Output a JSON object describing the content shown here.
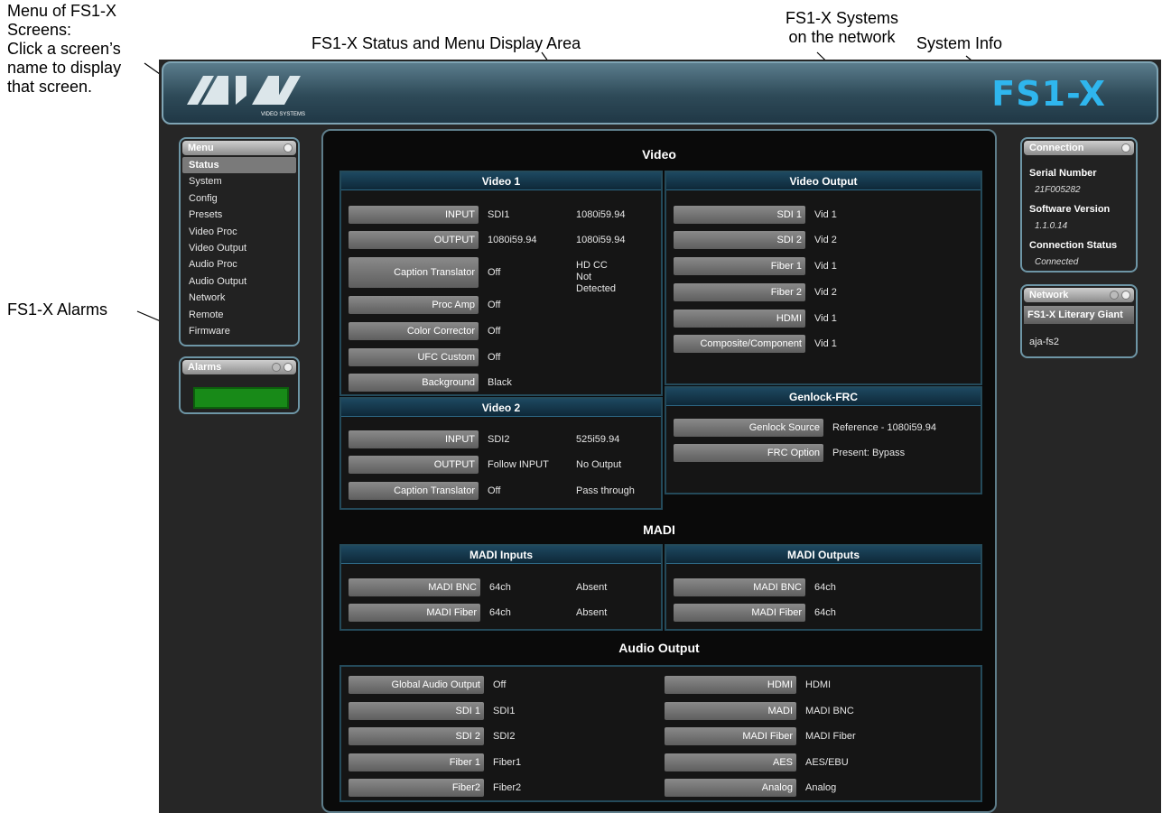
{
  "callouts": {
    "menu": "Menu of FS1-X\nScreens:\nClick a screen’s\nname to display\nthat screen.",
    "display_area": "FS1-X Status and Menu Display Area",
    "systems": "FS1-X Systems\non the network",
    "system_info": "System Info",
    "alarms": "FS1-X Alarms"
  },
  "header": {
    "logo_text": "AJA",
    "logo_sub": "VIDEO SYSTEMS",
    "product": "FS1-X",
    "accent": "#2fb6ee"
  },
  "menu": {
    "title": "Menu",
    "items": [
      {
        "label": "Status",
        "selected": true
      },
      {
        "label": "System"
      },
      {
        "label": "Config"
      },
      {
        "label": "Presets"
      },
      {
        "label": "Video Proc"
      },
      {
        "label": "Video Output"
      },
      {
        "label": "Audio Proc"
      },
      {
        "label": "Audio Output"
      },
      {
        "label": "Network"
      },
      {
        "label": "Remote"
      },
      {
        "label": "Firmware"
      }
    ]
  },
  "alarms": {
    "title": "Alarms",
    "status_color": "#188a18"
  },
  "connection": {
    "title": "Connection",
    "serial_label": "Serial Number",
    "serial_value": "21F005282",
    "software_label": "Software Version",
    "software_value": "1.1.0.14",
    "status_label": "Connection Status",
    "status_value": "Connected"
  },
  "network": {
    "title": "Network",
    "systems": [
      "FS1-X Literary Giant",
      "aja-fs2"
    ]
  },
  "video": {
    "heading": "Video",
    "video1": {
      "title": "Video 1",
      "rows": [
        {
          "btn": "INPUT",
          "v1": "SDI1",
          "v2": "1080i59.94"
        },
        {
          "btn": "OUTPUT",
          "v1": "1080i59.94",
          "v2": "1080i59.94"
        },
        {
          "btn": "Caption Translator",
          "v1": "Off",
          "v2": "HD CC Not\nDetected"
        },
        {
          "btn": "Proc Amp",
          "v1": "Off",
          "v2": ""
        },
        {
          "btn": "Color Corrector",
          "v1": "Off",
          "v2": ""
        },
        {
          "btn": "UFC Custom",
          "v1": "Off",
          "v2": ""
        },
        {
          "btn": "Background",
          "v1": "Black",
          "v2": ""
        }
      ]
    },
    "video2": {
      "title": "Video 2",
      "rows": [
        {
          "btn": "INPUT",
          "v1": "SDI2",
          "v2": "525i59.94"
        },
        {
          "btn": "OUTPUT",
          "v1": "Follow INPUT",
          "v2": "No Output"
        },
        {
          "btn": "Caption Translator",
          "v1": "Off",
          "v2": "Pass through"
        }
      ]
    },
    "output": {
      "title": "Video Output",
      "rows": [
        {
          "btn": "SDI 1",
          "v1": "Vid 1"
        },
        {
          "btn": "SDI 2",
          "v1": "Vid 2"
        },
        {
          "btn": "Fiber 1",
          "v1": "Vid 1"
        },
        {
          "btn": "Fiber 2",
          "v1": "Vid 2"
        },
        {
          "btn": "HDMI",
          "v1": "Vid 1"
        },
        {
          "btn": "Composite/Component",
          "v1": "Vid 1"
        }
      ]
    },
    "genlock": {
      "title": "Genlock-FRC",
      "rows": [
        {
          "btn": "Genlock Source",
          "v1": "Reference - 1080i59.94"
        },
        {
          "btn": "FRC Option",
          "v1": "Present: Bypass"
        }
      ]
    }
  },
  "madi": {
    "heading": "MADI",
    "inputs": {
      "title": "MADI Inputs",
      "rows": [
        {
          "btn": "MADI BNC",
          "v1": "64ch",
          "v2": "Absent"
        },
        {
          "btn": "MADI Fiber",
          "v1": "64ch",
          "v2": "Absent"
        }
      ]
    },
    "outputs": {
      "title": "MADI Outputs",
      "rows": [
        {
          "btn": "MADI BNC",
          "v1": "64ch"
        },
        {
          "btn": "MADI Fiber",
          "v1": "64ch"
        }
      ]
    }
  },
  "audio": {
    "heading": "Audio Output",
    "left": [
      {
        "btn": "Global Audio Output",
        "v1": "Off"
      },
      {
        "btn": "SDI 1",
        "v1": "SDI1"
      },
      {
        "btn": "SDI 2",
        "v1": "SDI2"
      },
      {
        "btn": "Fiber 1",
        "v1": "Fiber1"
      },
      {
        "btn": "Fiber2",
        "v1": "Fiber2"
      }
    ],
    "right": [
      {
        "btn": "HDMI",
        "v1": "HDMI"
      },
      {
        "btn": "MADI",
        "v1": "MADI BNC"
      },
      {
        "btn": "MADI Fiber",
        "v1": "MADI Fiber"
      },
      {
        "btn": "AES",
        "v1": "AES/EBU"
      },
      {
        "btn": "Analog",
        "v1": "Analog"
      }
    ]
  }
}
